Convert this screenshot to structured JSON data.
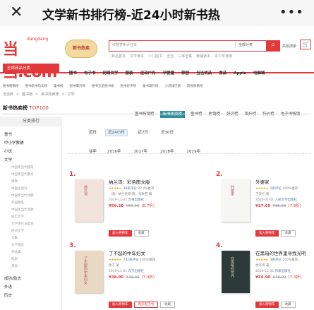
{
  "mobile_bar": {
    "close_glyph": "✕",
    "title": "文学新书排行榜-近24小时新书热",
    "more_glyph": "•••"
  },
  "header": {
    "logo_text": "当当.com",
    "logo_sub": "dangdang",
    "badge_text": "新书热卖",
    "search_placeholder": "红楼梦新评注本",
    "search_category": "全部分类",
    "search_icon": "search-icon",
    "advanced_search": "高级搜索",
    "cart_icon": "cart-icon",
    "hot_words": [
      "新品首发",
      "文学读本",
      "少儿图书",
      "当当",
      "三体全集",
      "教辅读本",
      "青少年读物"
    ]
  },
  "nav": {
    "all_categories": "全部商品分类",
    "items": [
      "图书",
      "电子书",
      "网络文学",
      "服装",
      "运动户外",
      "孕婴童",
      "家居",
      "当当优品",
      "食品",
      "Apple",
      "电脑城"
    ]
  },
  "subnav": {
    "items": [
      "图书畅销榜",
      "图书新书热卖榜",
      "童书榜",
      "图书飙升榜",
      "图书五星图书榜",
      "图书好评榜",
      "童书飙升榜",
      "小说排行榜",
      "影视原著榜"
    ]
  },
  "breadcrumb": [
    "当当网",
    ">",
    "图书榜",
    ">",
    "新书热卖榜",
    ">",
    "文学"
  ],
  "page_title": {
    "main": "新书热卖榜",
    "accent": "TOP100"
  },
  "rank_tabs": [
    {
      "label": "图书畅销榜",
      "active": false
    },
    {
      "label": "新书热卖榜",
      "active": true
    },
    {
      "label": "童书榜",
      "active": false
    },
    {
      "label": "热销榜",
      "active": false
    },
    {
      "label": "好评榜",
      "active": false
    },
    {
      "label": "飙升榜",
      "active": false
    },
    {
      "label": "特价榜",
      "active": false
    },
    {
      "label": "电子书畅销",
      "active": false
    }
  ],
  "sidebar": {
    "header": "分类排行",
    "items": [
      {
        "label": "童书",
        "type": "main"
      },
      {
        "label": "中小学教辅",
        "type": "main"
      },
      {
        "label": "小说",
        "type": "main"
      },
      {
        "label": "文学",
        "type": "main"
      },
      {
        "label": "中国现当代随笔",
        "type": "sub"
      },
      {
        "label": "中国现当代散文",
        "type": "sub"
      },
      {
        "label": "诗歌",
        "type": "sub"
      },
      {
        "label": "中国古诗词",
        "type": "sub"
      },
      {
        "label": "中国现当代诗歌",
        "type": "sub"
      },
      {
        "label": "外国随笔",
        "type": "sub"
      },
      {
        "label": "中国现当代诗歌",
        "type": "sub"
      },
      {
        "label": "纪实文学",
        "type": "sub"
      },
      {
        "label": "文学评论与鉴赏",
        "type": "sub"
      },
      {
        "label": "民间文学",
        "type": "sub"
      },
      {
        "label": "文集",
        "type": "sub"
      },
      {
        "label": "文学理论",
        "type": "sub"
      },
      {
        "label": "作品集",
        "type": "sub"
      },
      {
        "label": "戏剧",
        "type": "sub"
      },
      {
        "label": "其他",
        "type": "sub"
      },
      {
        "label": "成功/励志",
        "type": "main"
      },
      {
        "label": "外语",
        "type": "main"
      },
      {
        "label": "历史",
        "type": "main"
      }
    ]
  },
  "filters": {
    "recent": {
      "label": "近日",
      "options": [
        {
          "label": "近24小时",
          "active": true
        },
        {
          "label": "近7日",
          "active": false
        },
        {
          "label": "近30日",
          "active": false
        }
      ]
    },
    "year": {
      "label": "往年",
      "options": [
        {
          "label": "2016年",
          "active": false
        },
        {
          "label": "2017年",
          "active": false
        },
        {
          "label": "2018年",
          "active": false
        },
        {
          "label": "2019年",
          "active": false
        }
      ]
    }
  },
  "books": [
    {
      "rank": "1.",
      "title": "纳兰词：彩色图文版",
      "stars": "★★★★★",
      "reviews": "38条评论",
      "recommend": "97.4%推荐",
      "author": "（清）纳兰性德  著，张秋芸  编",
      "date": "2019-11-01",
      "publisher": "吉林出版社",
      "price": "¥59.20",
      "old_price": "¥69.00",
      "discount": "(8.7折)",
      "cover_title": "纳兰词",
      "cover_color": "#f2e3dc"
    },
    {
      "rank": "2.",
      "title": "外婆家",
      "stars": "★★★★★",
      "reviews": "1条评论",
      "recommend": "100%推荐",
      "author": "王安忆  著",
      "date": "2020-01-01",
      "publisher": "人民文学出版社",
      "price": "¥27.65",
      "old_price": "¥35.00",
      "discount": "(7.9折)",
      "cover_title": "外婆家",
      "cover_color": "#f6f6f2"
    },
    {
      "rank": "3.",
      "title": "了不起的中年妇女",
      "stars": "★★★★★",
      "reviews": "742条评论",
      "recommend": "100%推荐",
      "author": "杨子  著",
      "date": "2019-11-01",
      "publisher": "东方出版社",
      "price": "¥38.90",
      "old_price": "¥49.00",
      "discount": "(7.9折)",
      "cover_title": "了不起的中年妇女",
      "cover_color": "#e9d9c2"
    },
    {
      "rank": "4.",
      "title": "在黑暗的世界里寻找光明",
      "stars": "★★★★★",
      "reviews": "3条评论",
      "recommend": "100%推荐",
      "author": "余华等  著",
      "date": "2019-12-01",
      "publisher": "作家出版社",
      "price": "¥34.90",
      "old_price": "¥48.00",
      "discount": "(7.3折)",
      "cover_title": "在黑暗的世界",
      "cover_color": "#2c3b3a"
    }
  ],
  "card_buttons": {
    "cart": "加入购物车",
    "buy": "购买电子书",
    "fav": "收藏"
  },
  "colors": {
    "brand_red": "#e4393c",
    "active_tab": "#2f8f9d",
    "star": "#f6a623"
  }
}
